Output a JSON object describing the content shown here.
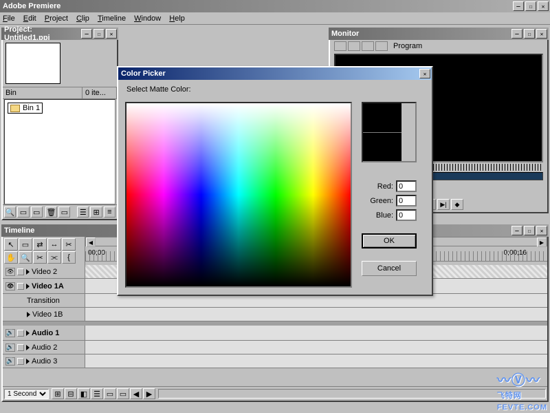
{
  "app": {
    "title": "Adobe Premiere"
  },
  "menu": {
    "file": "File",
    "edit": "Edit",
    "project": "Project",
    "clip": "Clip",
    "timeline": "Timeline",
    "window": "Window",
    "help": "Help"
  },
  "project": {
    "title": "Project: Untitled1.ppj",
    "bin_header": "Bin",
    "items_header": "0 ite...",
    "bin1": "Bin 1"
  },
  "monitor": {
    "title": "Monitor",
    "program_label": "Program"
  },
  "timeline": {
    "title": "Timeline",
    "time_start": "00;00",
    "time_end": "0;00;16",
    "tracks": {
      "video2": "Video 2",
      "video1a": "Video 1A",
      "transition": "Transition",
      "video1b": "Video 1B",
      "audio1": "Audio 1",
      "audio2": "Audio 2",
      "audio3": "Audio 3"
    },
    "zoom": "1 Second"
  },
  "color_picker": {
    "title": "Color Picker",
    "prompt": "Select Matte Color:",
    "red_label": "Red:",
    "green_label": "Green:",
    "blue_label": "Blue:",
    "red": "0",
    "green": "0",
    "blue": "0",
    "ok": "OK",
    "cancel": "Cancel"
  },
  "watermark": {
    "text1": "飞特网",
    "text2": "FEVTE.COM"
  }
}
